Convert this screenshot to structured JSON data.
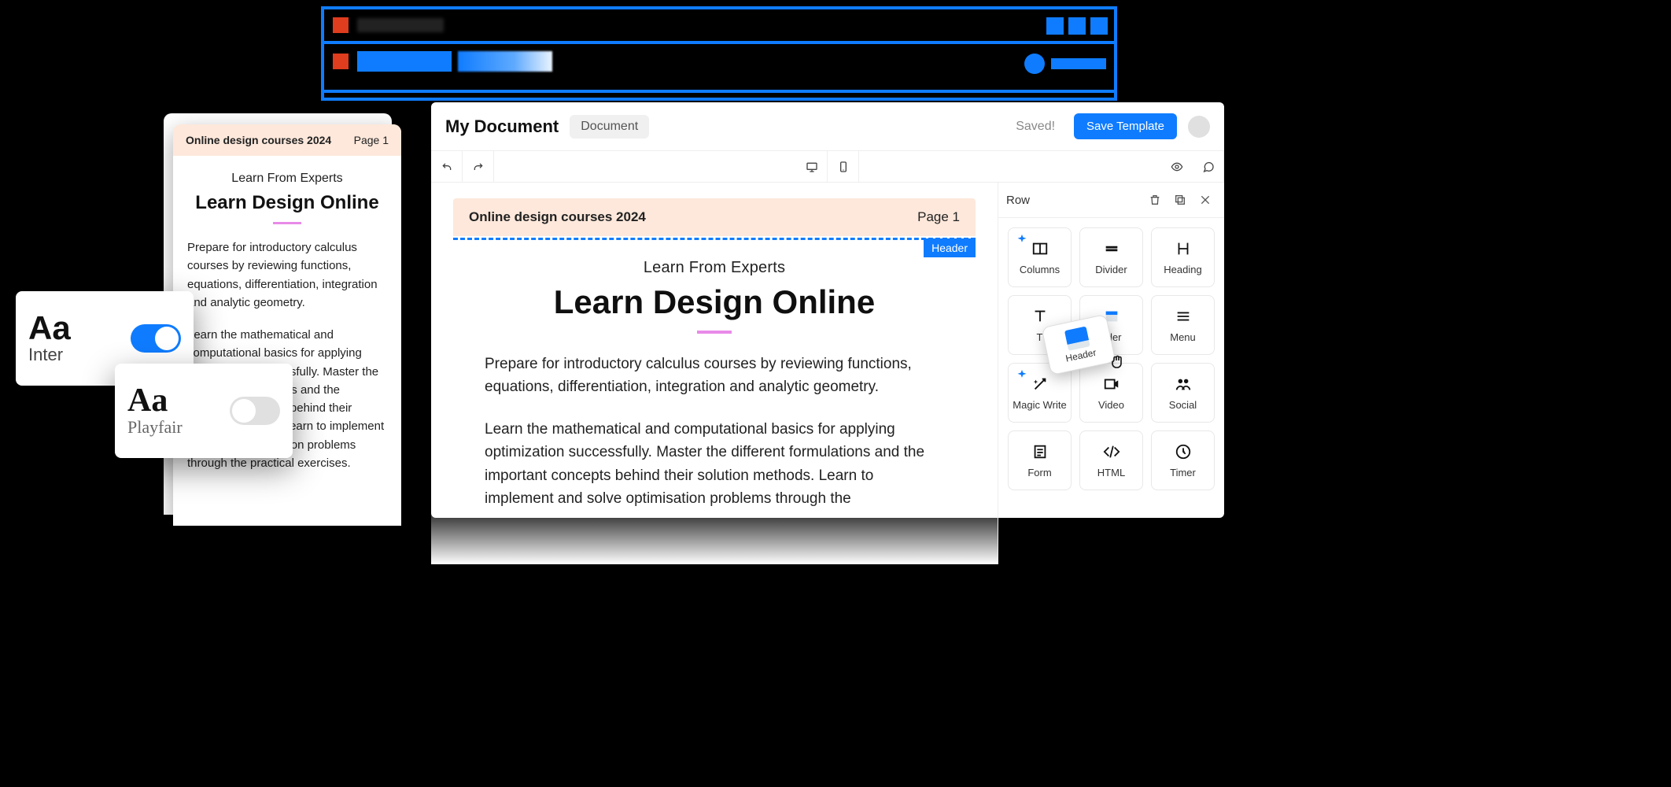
{
  "app": {
    "title": "My Document",
    "type_pill": "Document",
    "status": "Saved!",
    "save_btn": "Save Template"
  },
  "panel": {
    "title": "Row",
    "items": {
      "columns": "Columns",
      "divider": "Divider",
      "heading": "Heading",
      "text": "T",
      "header": "ader",
      "menu": "Menu",
      "magic": "Magic Write",
      "video": "Video",
      "social": "Social",
      "form": "Form",
      "html": "HTML",
      "timer": "Timer"
    },
    "drag_label": "Header"
  },
  "doc": {
    "header_left": "Online design courses 2024",
    "header_right": "Page 1",
    "selection_chip": "Header",
    "overline": "Learn From Experts",
    "title": "Learn Design Online",
    "p1": "Prepare for introductory calculus courses by reviewing functions, equations, differentiation, integration and analytic geometry.",
    "p2": "Learn the mathematical and computational basics for applying optimization successfully. Master the different formulations and the important concepts behind their solution methods. Learn to implement and solve optimisation problems through the"
  },
  "mobile": {
    "header_left": "Online design courses 2024",
    "header_right": "Page 1",
    "overline": "Learn From Experts",
    "title": "Learn Design Online",
    "p1": "Prepare for introductory calculus courses by reviewing functions, equations, differentiation, integration and analytic geometry.",
    "p2": "Learn the mathematical and computational basics for applying optimization successfully. Master the different formulations and the important concepts behind their solution methods. Learn to implement and solve optimisation problems through the practical exercises."
  },
  "fonts": {
    "f1_sample": "Aa",
    "f1_name": "Inter",
    "f2_sample": "Aa",
    "f2_name": "Playfair"
  }
}
